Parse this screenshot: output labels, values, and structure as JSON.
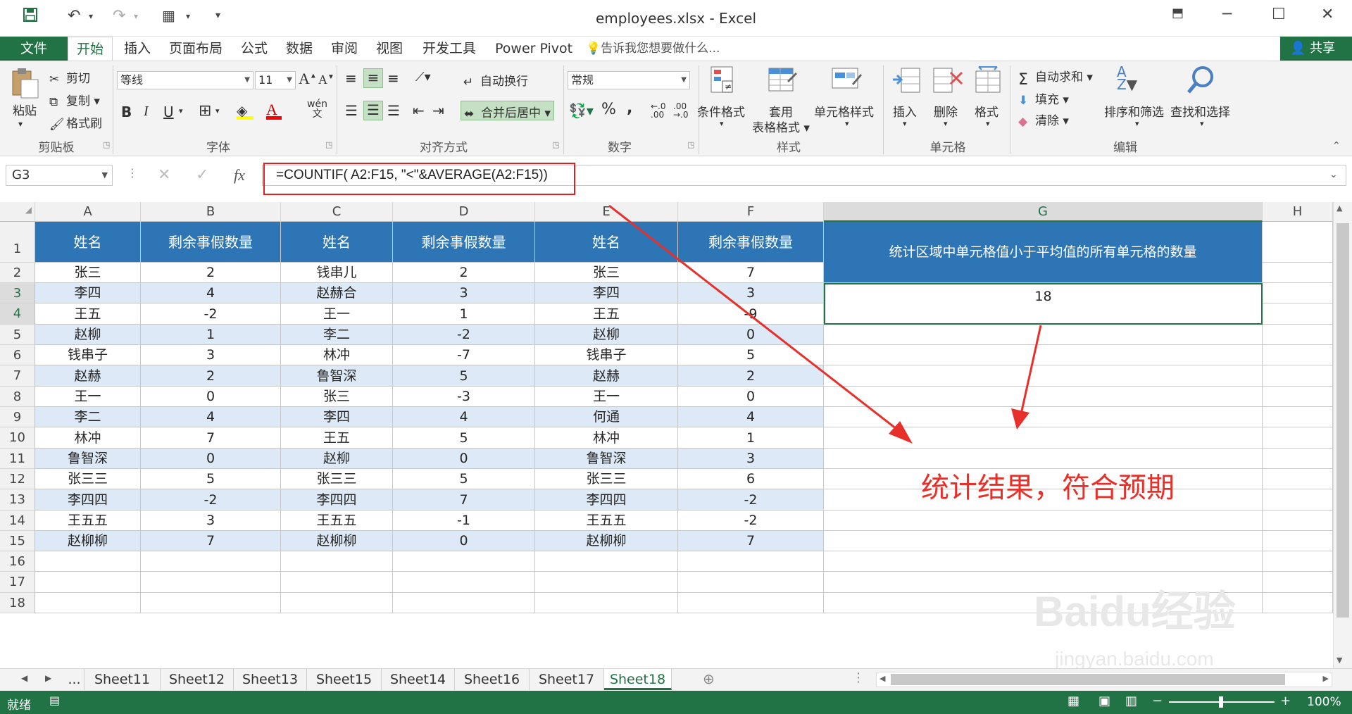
{
  "window": {
    "title": "employees.xlsx - Excel",
    "file_tab": "文件",
    "share": "共享"
  },
  "tabs": [
    "开始",
    "插入",
    "页面布局",
    "公式",
    "数据",
    "审阅",
    "视图",
    "开发工具",
    "Power Pivot"
  ],
  "tell_me": "告诉我您想要做什么...",
  "ribbon": {
    "clipboard": {
      "paste": "粘贴",
      "cut": "剪切",
      "copy": "复制",
      "format_painter": "格式刷",
      "label": "剪贴板"
    },
    "font": {
      "name": "等线",
      "size": "11",
      "label": "字体",
      "bold": "B",
      "italic": "I",
      "underline": "U",
      "inc": "A",
      "dec": "A",
      "wen": "wén"
    },
    "alignment": {
      "wrap": "自动换行",
      "merge": "合并后居中",
      "label": "对齐方式"
    },
    "number": {
      "format": "常规",
      "percent": "%",
      "comma": ",",
      "label": "数字"
    },
    "styles": {
      "conditional": "条件格式",
      "table": "套用",
      "table2": "表格格式",
      "cell": "单元格样式",
      "label": "样式"
    },
    "cells": {
      "insert": "插入",
      "delete": "删除",
      "format": "格式",
      "label": "单元格"
    },
    "editing": {
      "autosum": "自动求和",
      "fill": "填充",
      "clear": "清除",
      "sort": "排序和筛选",
      "find": "查找和选择",
      "label": "编辑"
    }
  },
  "formula_bar": {
    "name_box": "G3",
    "fx": "fx",
    "formula": "=COUNTIF( A2:F15, \"<\"&AVERAGE(A2:F15))"
  },
  "columns": [
    "A",
    "B",
    "C",
    "D",
    "E",
    "F",
    "G",
    "H"
  ],
  "rows": [
    "1",
    "2",
    "3",
    "4",
    "5",
    "6",
    "7",
    "8",
    "9",
    "10",
    "11",
    "12",
    "13",
    "14",
    "15",
    "16",
    "17",
    "18"
  ],
  "table": {
    "headers": [
      "姓名",
      "剩余事假数量",
      "姓名",
      "剩余事假数量",
      "姓名",
      "剩余事假数量"
    ],
    "data": [
      [
        "张三",
        "2",
        "钱串儿",
        "2",
        "张三",
        "7"
      ],
      [
        "李四",
        "4",
        "赵赫合",
        "3",
        "李四",
        "3"
      ],
      [
        "王五",
        "-2",
        "王一",
        "1",
        "王五",
        "-9"
      ],
      [
        "赵柳",
        "1",
        "李二",
        "-2",
        "赵柳",
        "0"
      ],
      [
        "钱串子",
        "3",
        "林冲",
        "-7",
        "钱串子",
        "5"
      ],
      [
        "赵赫",
        "2",
        "鲁智深",
        "5",
        "赵赫",
        "2"
      ],
      [
        "王一",
        "0",
        "张三",
        "-3",
        "王一",
        "0"
      ],
      [
        "李二",
        "4",
        "李四",
        "4",
        "何通",
        "4"
      ],
      [
        "林冲",
        "7",
        "王五",
        "5",
        "林冲",
        "1"
      ],
      [
        "鲁智深",
        "0",
        "赵柳",
        "0",
        "鲁智深",
        "3"
      ],
      [
        "张三三",
        "5",
        "张三三",
        "5",
        "张三三",
        "6"
      ],
      [
        "李四四",
        "-2",
        "李四四",
        "7",
        "李四四",
        "-2"
      ],
      [
        "王五五",
        "3",
        "王五五",
        "-1",
        "王五五",
        "-2"
      ],
      [
        "赵柳柳",
        "7",
        "赵柳柳",
        "0",
        "赵柳柳",
        "7"
      ]
    ]
  },
  "g_header": "统计区域中单元格值小于平均值的所有单元格的数量",
  "g_result": "18",
  "annotation": "统计结果，符合预期",
  "sheets": [
    "...",
    "Sheet11",
    "Sheet12",
    "Sheet13",
    "Sheet15",
    "Sheet14",
    "Sheet16",
    "Sheet17",
    "Sheet18"
  ],
  "active_sheet": "Sheet18",
  "status": {
    "ready": "就绪",
    "zoom": "100%"
  },
  "watermark": {
    "brand": "Baidu经验",
    "url": "jingyan.baidu.com"
  },
  "colors": {
    "excel_green": "#217346",
    "header_blue": "#2e75b6",
    "alt_row": "#dde9f6",
    "annotation_red": "#e8302a"
  }
}
